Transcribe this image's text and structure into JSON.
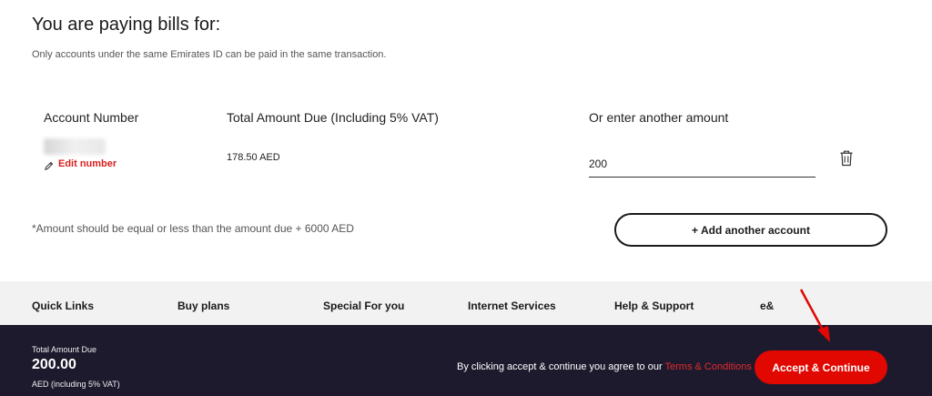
{
  "header": {
    "title": "You are paying bills for:",
    "subtitle": "Only accounts under the same Emirates ID can be paid in the same transaction."
  },
  "table": {
    "columns": [
      "Account Number",
      "Total Amount Due (Including 5% VAT)",
      "Or enter another amount"
    ],
    "row": {
      "edit_label": "Edit number",
      "amount_due": "178.50 AED",
      "other_amount_value": "200"
    }
  },
  "note": "*Amount should be equal or less than the amount due + 6000 AED",
  "add_account_label": "+ Add another account",
  "footer_links": [
    "Quick Links",
    "Buy plans",
    "Special For you",
    "Internet Services",
    "Help & Support",
    "e&"
  ],
  "bottom_bar": {
    "total_label": "Total Amount Due",
    "total_amount": "200.00",
    "vat_label": "AED (including 5% VAT)",
    "consent_text": "By clicking accept & continue you agree to our ",
    "terms_link": "Terms & Conditions",
    "accept_label": "Accept & Continue"
  },
  "icons": {
    "edit": "pencil-icon",
    "delete": "trash-icon",
    "annotation": "red-arrow-icon"
  },
  "colors": {
    "accent": "#e00800",
    "link": "#d81e1e",
    "bottom_bar": "#1e1a2e",
    "footer_nav": "#f2f2f2"
  }
}
